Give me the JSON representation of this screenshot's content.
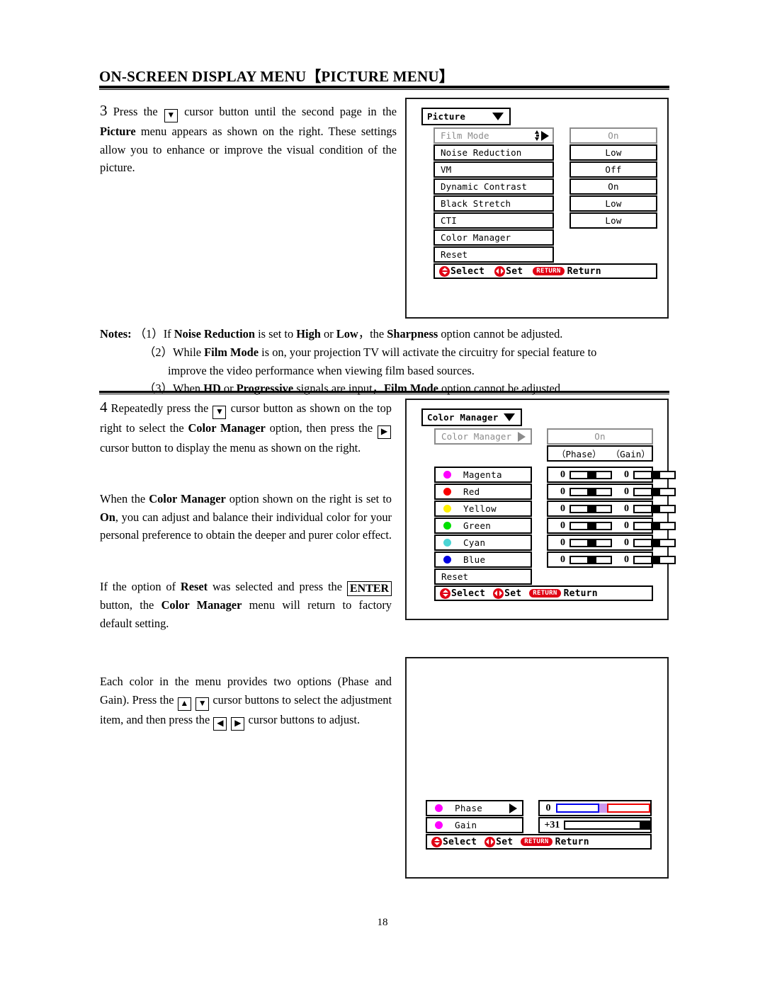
{
  "page": {
    "title": "ON-SCREEN DISPLAY MENU【PICTURE MENU】",
    "number": "18"
  },
  "steps": {
    "step3": {
      "number": "3",
      "text_a": "Press the",
      "key": "▼",
      "text_b": "cursor button until the second page in the",
      "text_c": "Picture",
      "text_d": " menu appears as shown on the right. These settings allow you to enhance or improve the visual condition of the picture."
    },
    "step4": {
      "number": "4",
      "text_a": "Repeatedly press the",
      "key_down": "▼",
      "text_b": "cursor button as shown on the top right to select the",
      "bold_a": "Color Manager",
      "text_c": "option, then press the",
      "key_right": "▶",
      "text_d": "cursor button to display the menu as shown on the right."
    }
  },
  "paragraphs": {
    "when_color_manager": {
      "p1": "When the ",
      "b1": "Color Manager",
      "p2": " option shown on the right is set to ",
      "b2": "On",
      "p3": ", you can adjust and balance their individual color for your personal preference to obtain the deeper and purer color effect."
    },
    "reset_note": {
      "p1": "If the option of ",
      "b1": "Reset",
      "p2": " was selected and press the ",
      "enter_key": "ENTER",
      "p3": " button, the ",
      "b2": "Color Manager",
      "p4": " menu will return to factory default setting."
    },
    "each_color": {
      "p1": "Each color in the menu provides two options (Phase and Gain). Press the ",
      "key_up": "▲",
      "key_down": "▼",
      "p2": " cursor buttons to select the adjustment item, and then press the ",
      "key_left": "◀",
      "key_right": "▶",
      "p3": " cursor buttons to adjust."
    }
  },
  "notes": {
    "label": "Notes:",
    "items": [
      {
        "marker": "（1）",
        "parts": [
          "If ",
          "Noise Reduction",
          " is set to ",
          "High",
          " or ",
          "Low",
          "，the ",
          "Sharpness",
          " option cannot be adjusted."
        ]
      },
      {
        "marker": "（2）",
        "line1_parts": [
          "While ",
          "Film Mode",
          " is on, your projection TV will activate the circuitry for special feature to"
        ],
        "line2": "improve the video performance when viewing film based sources."
      },
      {
        "marker": "（3）",
        "parts": [
          "When ",
          "HD",
          " or ",
          "Progressive",
          " signals are input，",
          "Film Mode",
          " option cannot be adjusted."
        ]
      }
    ]
  },
  "osd_picture_menu": {
    "title": "Picture",
    "caret": "caret-down-icon",
    "rows": [
      {
        "label": "Film Mode",
        "value": "On",
        "dimmed": true,
        "indicator": "updown-right-arrow-icon"
      },
      {
        "label": "Noise Reduction",
        "value": "Low",
        "dimmed": false
      },
      {
        "label": "VM",
        "value": "Off",
        "dimmed": false
      },
      {
        "label": "Dynamic Contrast",
        "value": "On",
        "dimmed": false
      },
      {
        "label": "Black Stretch",
        "value": "Low",
        "dimmed": false
      },
      {
        "label": "CTI",
        "value": "Low",
        "dimmed": false
      },
      {
        "label": "Color Manager",
        "value": "",
        "dimmed": false
      },
      {
        "label": "Reset",
        "value": "",
        "dimmed": false
      }
    ],
    "help": {
      "select": "Select",
      "set": "Set",
      "return_badge": "RETURN",
      "return": "Return"
    }
  },
  "osd_color_manager": {
    "title": "Color Manager",
    "header_row": {
      "label": "Color Manager",
      "value": "On",
      "dimmed": true
    },
    "column_headers": {
      "phase": "（Phase）",
      "gain": "（Gain）"
    },
    "colors": [
      {
        "name": "Magenta",
        "swatch": "#ff00ff",
        "phase": "0",
        "gain": "0"
      },
      {
        "name": "Red",
        "swatch": "#fa0000",
        "phase": "0",
        "gain": "0"
      },
      {
        "name": "Yellow",
        "swatch": "#fff000",
        "phase": "0",
        "gain": "0"
      },
      {
        "name": "Green",
        "swatch": "#00e000",
        "phase": "0",
        "gain": "0"
      },
      {
        "name": "Cyan",
        "swatch": "#4bd5d5",
        "phase": "0",
        "gain": "0"
      },
      {
        "name": "Blue",
        "swatch": "#0000e0",
        "phase": "0",
        "gain": "0"
      }
    ],
    "reset_label": "Reset",
    "help": {
      "select": "Select",
      "set": "Set",
      "return_badge": "RETURN",
      "return": "Return"
    }
  },
  "osd_phase_gain": {
    "rows": [
      {
        "label": "Phase",
        "swatch": "#ff00ff",
        "value": "0",
        "arrow": "right-arrow-icon",
        "bar": {
          "type": "bipolar",
          "left_color": "#0000ee",
          "mid_color": "#cc99ee",
          "right_color": "#ee0000"
        }
      },
      {
        "label": "Gain",
        "swatch": "#ff00ff",
        "value": "+31",
        "arrow": "",
        "bar": {
          "type": "linear",
          "knob_position": "right",
          "color": "#000000"
        }
      }
    ],
    "help": {
      "select": "Select",
      "set": "Set",
      "return_badge": "RETURN",
      "return": "Return"
    }
  }
}
